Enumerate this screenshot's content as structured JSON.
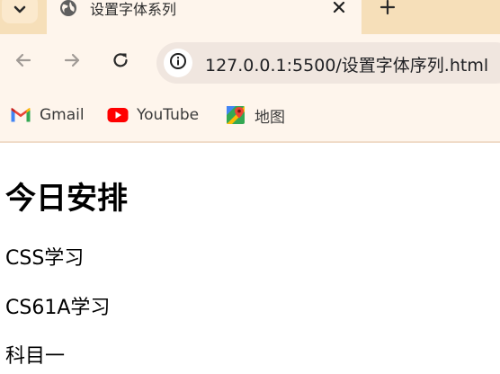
{
  "browser": {
    "tab": {
      "title": "设置字体系列"
    },
    "toolbar": {
      "url": "127.0.0.1:5500/设置字体序列.html"
    },
    "bookmarks": [
      {
        "label": "Gmail",
        "icon": "gmail-icon"
      },
      {
        "label": "YouTube",
        "icon": "youtube-icon"
      },
      {
        "label": "地图",
        "icon": "maps-icon"
      }
    ],
    "colors": {
      "tabstrip": "#f6dfb9",
      "toolbar": "#fef5ec",
      "omnibox": "#f0e6df"
    }
  },
  "page": {
    "heading": "今日安排",
    "paragraphs": [
      "CSS学习",
      "CS61A学习",
      "科目一"
    ]
  }
}
